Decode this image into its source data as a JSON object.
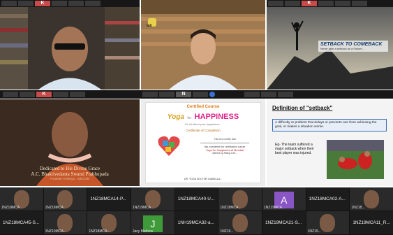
{
  "top_strips": {
    "left": {
      "thumbs": [
        "",
        "",
        "K",
        "",
        "",
        ""
      ]
    },
    "right": {
      "thumbs": [
        "",
        "",
        "K",
        "",
        "",
        ""
      ]
    }
  },
  "row1": {
    "cell_mid": {
      "badge": "tab"
    },
    "cell_right": {
      "slide_title": "SETBACK TO COMEBACK",
      "slide_sub": "Never take a setback as a Failure..."
    }
  },
  "mid_strip": {
    "thumbs": [
      "",
      "",
      "K",
      "",
      "",
      "",
      "",
      "N",
      "",
      ""
    ]
  },
  "row2": {
    "dedication": {
      "line1": "Dedicated to His Divine Grace",
      "line2": "A.C. Bhaktivedanta Swami Prabhupada",
      "line3": "Founder-Acharya : ISKCON"
    },
    "certificate": {
      "header": "Certified Course",
      "brand_left": "Yoga",
      "brand_mid": "for",
      "brand_right": "HAPPINESS",
      "tagline": "it's all about your happiness...",
      "cert_title": "Certificate of Completion",
      "body_lines": [
        "This is to certify that",
        "has completed the certification course",
        "Yoga for Happiness at Mumbai",
        "offered by Rising Life..."
      ],
      "footer": "DR. YOGA DOCTOR  GIANELLA..."
    },
    "definition": {
      "title": "Definition of \"setback\"",
      "definition_text": "A difficulty or problem that delays or prevents one from achieving the goal, or makes a situation worse.",
      "example_text": "Eg- The team suffered a major setback when their best player was injured."
    }
  },
  "gallery": [
    {
      "label": "1NZ18MCA...",
      "kind": "face",
      "color": "#3a3a3a"
    },
    {
      "label": "1NZ18MCA...",
      "kind": "face",
      "color": "#3a3a3a"
    },
    {
      "label": "1NZ18MCA14-P...",
      "kind": "name",
      "color": "#1c1c1c"
    },
    {
      "label": "1NZ19MCA...",
      "kind": "face",
      "color": "#3a3a3a"
    },
    {
      "label": "1NZ18MCA40-U...",
      "kind": "name",
      "color": "#1c1c1c"
    },
    {
      "label": "1NZ18MCA...",
      "kind": "face",
      "color": "#3a3a3a"
    },
    {
      "label": "1NZ19MCA...",
      "kind": "letter",
      "letter": "A",
      "color": "#8a55c4"
    },
    {
      "label": "1NZ18MCA02-A...",
      "kind": "name",
      "color": "#1c1c1c"
    },
    {
      "label": "1NZ18...",
      "kind": "face",
      "color": "#3a3a3a"
    },
    {
      "label": "1NZ18MCA45-S...",
      "kind": "name",
      "color": "#1c1c1c"
    },
    {
      "label": "1NZ19MCA...",
      "kind": "face",
      "color": "#3a3a3a"
    },
    {
      "label": "1NZ18MCA...",
      "kind": "face",
      "color": "#3a3a3a"
    },
    {
      "label": "Jacy Mathew",
      "kind": "letter",
      "letter": "J",
      "color": "#3f9a3a"
    },
    {
      "label": "1NH19MCA32-a...",
      "kind": "name",
      "color": "#1c1c1c"
    },
    {
      "label": "1NZ19...",
      "kind": "face",
      "color": "#3a3a3a"
    },
    {
      "label": "1NZ19MCA21-S...",
      "kind": "name",
      "color": "#1c1c1c"
    },
    {
      "label": "1NZ19...",
      "kind": "face",
      "color": "#3a3a3a"
    },
    {
      "label": "1NZ19MCA11_R...",
      "kind": "name",
      "color": "#1c1c1c"
    }
  ]
}
